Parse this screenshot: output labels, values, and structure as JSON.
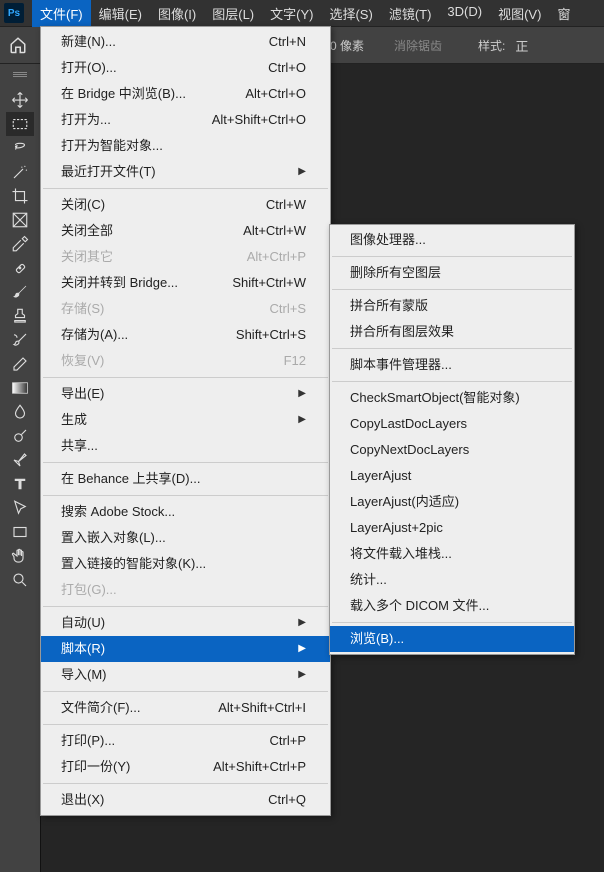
{
  "menubar": {
    "items": [
      "文件(F)",
      "编辑(E)",
      "图像(I)",
      "图层(L)",
      "文字(Y)",
      "选择(S)",
      "滤镜(T)",
      "3D(D)",
      "视图(V)",
      "窗"
    ]
  },
  "optionsbar": {
    "pixels_label": "0 像素",
    "antialias": "消除锯齿",
    "style": "样式:",
    "fixed": "正"
  },
  "file_menu": [
    {
      "label": "新建(N)...",
      "shortcut": "Ctrl+N"
    },
    {
      "label": "打开(O)...",
      "shortcut": "Ctrl+O"
    },
    {
      "label": "在 Bridge 中浏览(B)...",
      "shortcut": "Alt+Ctrl+O"
    },
    {
      "label": "打开为...",
      "shortcut": "Alt+Shift+Ctrl+O"
    },
    {
      "label": "打开为智能对象..."
    },
    {
      "label": "最近打开文件(T)",
      "submenu": true
    },
    {
      "sep": true
    },
    {
      "label": "关闭(C)",
      "shortcut": "Ctrl+W"
    },
    {
      "label": "关闭全部",
      "shortcut": "Alt+Ctrl+W"
    },
    {
      "label": "关闭其它",
      "shortcut": "Alt+Ctrl+P",
      "disabled": true
    },
    {
      "label": "关闭并转到 Bridge...",
      "shortcut": "Shift+Ctrl+W"
    },
    {
      "label": "存储(S)",
      "shortcut": "Ctrl+S",
      "disabled": true
    },
    {
      "label": "存储为(A)...",
      "shortcut": "Shift+Ctrl+S"
    },
    {
      "label": "恢复(V)",
      "shortcut": "F12",
      "disabled": true
    },
    {
      "sep": true
    },
    {
      "label": "导出(E)",
      "submenu": true
    },
    {
      "label": "生成",
      "submenu": true
    },
    {
      "label": "共享..."
    },
    {
      "sep": true
    },
    {
      "label": "在 Behance 上共享(D)..."
    },
    {
      "sep": true
    },
    {
      "label": "搜索 Adobe Stock..."
    },
    {
      "label": "置入嵌入对象(L)..."
    },
    {
      "label": "置入链接的智能对象(K)..."
    },
    {
      "label": "打包(G)...",
      "disabled": true
    },
    {
      "sep": true
    },
    {
      "label": "自动(U)",
      "submenu": true
    },
    {
      "label": "脚本(R)",
      "submenu": true,
      "highlight": true
    },
    {
      "label": "导入(M)",
      "submenu": true
    },
    {
      "sep": true
    },
    {
      "label": "文件简介(F)...",
      "shortcut": "Alt+Shift+Ctrl+I"
    },
    {
      "sep": true
    },
    {
      "label": "打印(P)...",
      "shortcut": "Ctrl+P"
    },
    {
      "label": "打印一份(Y)",
      "shortcut": "Alt+Shift+Ctrl+P"
    },
    {
      "sep": true
    },
    {
      "label": "退出(X)",
      "shortcut": "Ctrl+Q"
    }
  ],
  "script_submenu": [
    {
      "label": "图像处理器..."
    },
    {
      "sep": true
    },
    {
      "label": "删除所有空图层"
    },
    {
      "sep": true
    },
    {
      "label": "拼合所有蒙版"
    },
    {
      "label": "拼合所有图层效果"
    },
    {
      "sep": true
    },
    {
      "label": "脚本事件管理器..."
    },
    {
      "sep": true
    },
    {
      "label": "CheckSmartObject(智能对象)"
    },
    {
      "label": "CopyLastDocLayers"
    },
    {
      "label": "CopyNextDocLayers"
    },
    {
      "label": "LayerAjust"
    },
    {
      "label": "LayerAjust(内适应)"
    },
    {
      "label": "LayerAjust+2pic"
    },
    {
      "label": "将文件载入堆栈..."
    },
    {
      "label": "统计..."
    },
    {
      "label": "载入多个 DICOM 文件..."
    },
    {
      "sep": true
    },
    {
      "label": "浏览(B)...",
      "highlight": true
    }
  ],
  "tools": [
    "move",
    "marquee",
    "lasso",
    "wand",
    "crop",
    "frame",
    "eyedropper",
    "heal",
    "brush",
    "stamp",
    "history-brush",
    "eraser",
    "gradient",
    "blur",
    "dodge",
    "pen",
    "type",
    "path-select",
    "rectangle",
    "hand",
    "zoom"
  ]
}
